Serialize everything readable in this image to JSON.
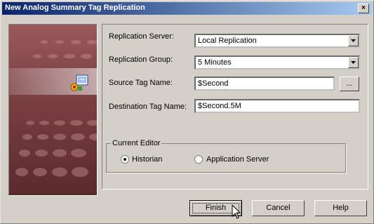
{
  "window": {
    "title": "New Analog Summary Tag Replication"
  },
  "title_bar": {
    "close_glyph": "×"
  },
  "form": {
    "replication_server": {
      "label": "Replication Server:",
      "value": "Local Replication"
    },
    "replication_group": {
      "label": "Replication Group:",
      "value": "5 Minutes"
    },
    "source_tag": {
      "label": "Source Tag Name:",
      "value": "$Second",
      "browse_label": "..."
    },
    "destination_tag": {
      "label": "Destination Tag Name:",
      "value": "$Second.5M"
    }
  },
  "current_editor": {
    "legend": "Current Editor",
    "options": [
      {
        "label": "Historian",
        "selected": true
      },
      {
        "label": "Application Server",
        "selected": false
      }
    ]
  },
  "buttons": {
    "finish": "Finish",
    "cancel": "Cancel",
    "help": "Help"
  },
  "colors": {
    "title_bar_start": "#0a246a",
    "title_bar_end": "#a6caf0",
    "dialog_bg": "#d4d0c8",
    "banner": "#7e4345"
  }
}
